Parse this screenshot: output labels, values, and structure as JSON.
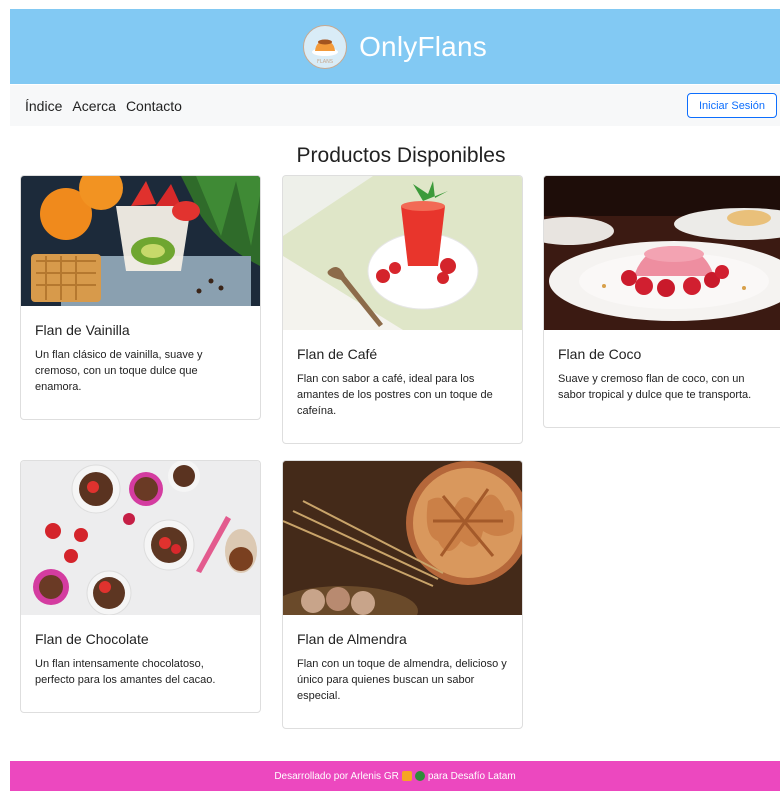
{
  "header": {
    "brand_name": "OnlyFlans",
    "logo_icon": "flan-logo-icon",
    "background": "#82c9f3"
  },
  "nav": {
    "links": [
      "Índice",
      "Acerca",
      "Contacto"
    ],
    "login_label": "Iniciar Sesión"
  },
  "section": {
    "title": "Productos Disponibles"
  },
  "products": [
    {
      "name": "Flan de Vainilla",
      "description": "Un flan clásico de vainilla, suave y cremoso, con un toque dulce que enamora.",
      "image_icon": "vanilla-dessert-photo"
    },
    {
      "name": "Flan de Café",
      "description": "Flan con sabor a café, ideal para los amantes de los postres con un toque de cafeína.",
      "image_icon": "coffee-dessert-photo"
    },
    {
      "name": "Flan de Coco",
      "description": "Suave y cremoso flan de coco, con un sabor tropical y dulce que te transporta.",
      "image_icon": "coconut-dessert-photo"
    },
    {
      "name": "Flan de Chocolate",
      "description": "Un flan intensamente chocolatoso, perfecto para los amantes del cacao.",
      "image_icon": "chocolate-dessert-photo"
    },
    {
      "name": "Flan de Almendra",
      "description": "Flan con un toque de almendra, delicioso y único para quienes buscan un sabor especial.",
      "image_icon": "almond-pie-photo"
    }
  ],
  "footer": {
    "text_before": "Desarrollado por Arlenis GR",
    "text_after": "para Desafío Latam",
    "background": "#ec48bf"
  }
}
